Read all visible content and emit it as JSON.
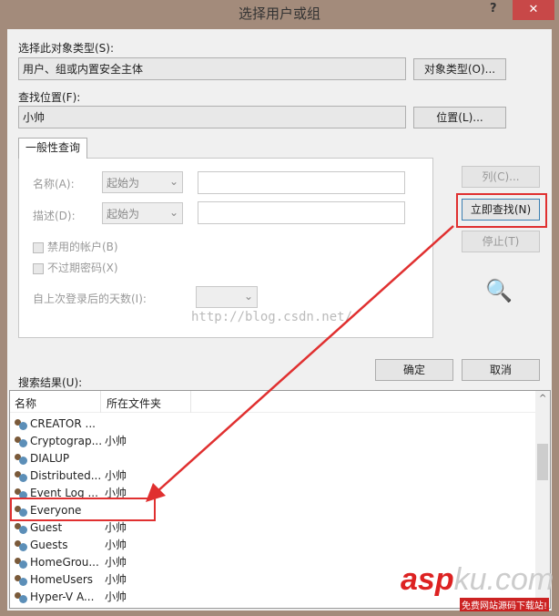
{
  "window": {
    "title": "选择用户或组",
    "help": "?",
    "close": "✕"
  },
  "object_type": {
    "label": "选择此对象类型(S):",
    "value": "用户、组或内置安全主体",
    "button": "对象类型(O)..."
  },
  "location": {
    "label": "查找位置(F):",
    "value": "小帅",
    "button": "位置(L)..."
  },
  "query": {
    "tab": "一般性查询",
    "name_label": "名称(A):",
    "name_mode": "起始为",
    "desc_label": "描述(D):",
    "desc_mode": "起始为",
    "disabled_accounts": "禁用的帐户(B)",
    "no_expire": "不过期密码(X)",
    "days_label": "自上次登录后的天数(I):"
  },
  "side_buttons": {
    "columns": "列(C)...",
    "find_now": "立即查找(N)",
    "stop": "停止(T)"
  },
  "ok": "确定",
  "cancel": "取消",
  "results": {
    "label": "搜索结果(U):",
    "columns": [
      "名称",
      "所在文件夹"
    ],
    "rows": [
      {
        "name": "CREATOR ...",
        "folder": ""
      },
      {
        "name": "Cryptograp...",
        "folder": "小帅"
      },
      {
        "name": "DIALUP",
        "folder": ""
      },
      {
        "name": "Distributed...",
        "folder": "小帅"
      },
      {
        "name": "Event Log ...",
        "folder": "小帅"
      },
      {
        "name": "Everyone",
        "folder": ""
      },
      {
        "name": "Guest",
        "folder": "小帅"
      },
      {
        "name": "Guests",
        "folder": "小帅"
      },
      {
        "name": "HomeGrou...",
        "folder": "小帅"
      },
      {
        "name": "HomeUsers",
        "folder": "小帅"
      },
      {
        "name": "Hyper-V A...",
        "folder": "小帅"
      }
    ]
  },
  "watermarks": {
    "csdn": "http://blog.csdn.net/",
    "aspku": "aspku.com",
    "aspku_sub": "免费网站源码下载站!"
  },
  "colors": {
    "highlight": "#e03030",
    "titlebar": "#a38b7b"
  }
}
